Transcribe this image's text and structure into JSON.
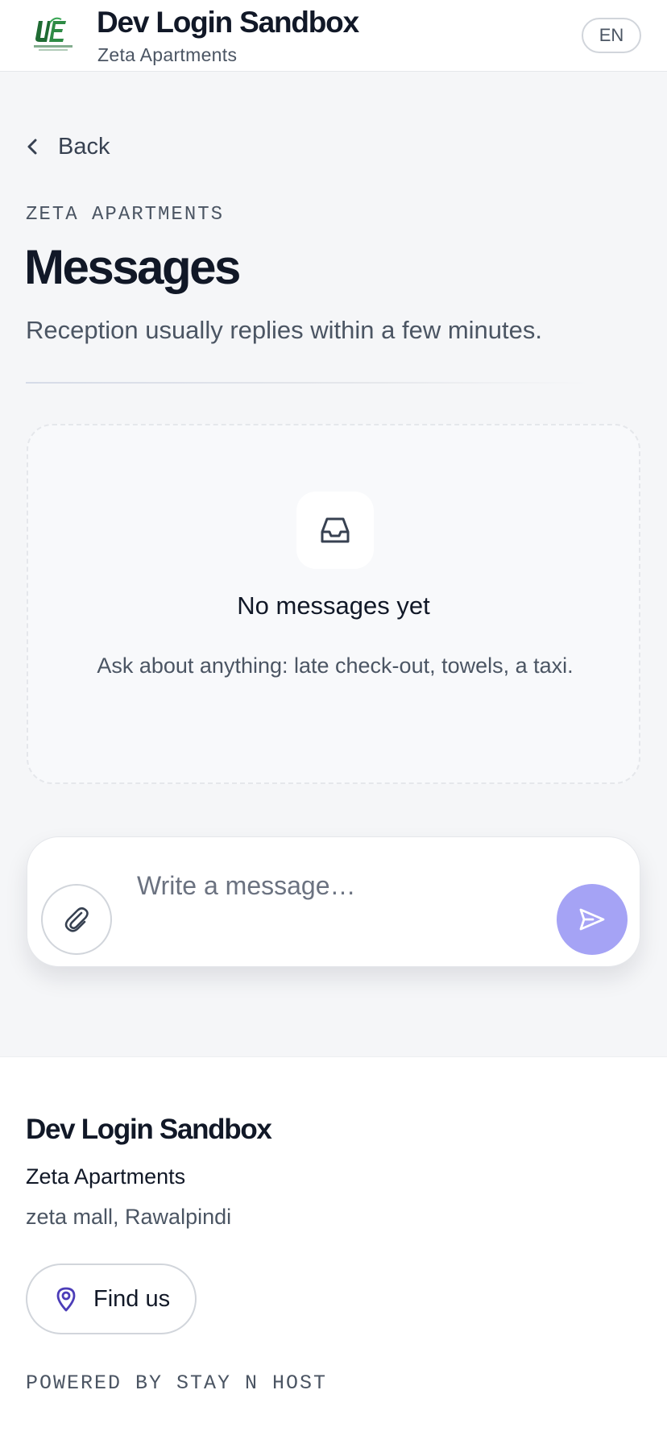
{
  "header": {
    "title": "Dev Login Sandbox",
    "subtitle": "Zeta Apartments",
    "language": "EN",
    "logo_icon": "urban-elan-logo"
  },
  "nav": {
    "back_label": "Back",
    "back_icon": "chevron-left-icon"
  },
  "page": {
    "eyebrow": "ZETA APARTMENTS",
    "title": "Messages",
    "subtitle": "Reception usually replies within a few minutes."
  },
  "empty_state": {
    "icon": "inbox-icon",
    "title": "No messages yet",
    "description": "Ask about anything: late check-out, towels, a taxi."
  },
  "composer": {
    "placeholder": "Write a message…",
    "value": "",
    "attach_icon": "paperclip-icon",
    "send_icon": "send-icon"
  },
  "footer": {
    "title": "Dev Login Sandbox",
    "property_name": "Zeta Apartments",
    "address": "zeta mall, Rawalpindi",
    "find_us_label": "Find us",
    "find_us_icon": "map-pin-icon",
    "powered_by": "POWERED BY STAY N HOST"
  },
  "colors": {
    "accent": "#4c3db8",
    "send_button": "#a5a3f5",
    "logo_green": "#1f7a3a",
    "background": "#f5f6f8"
  }
}
